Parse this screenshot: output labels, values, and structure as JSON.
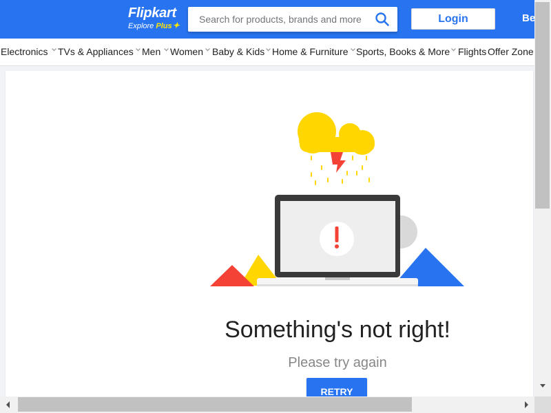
{
  "header": {
    "logo_main": "Flipkart",
    "logo_sub": "Explore",
    "logo_plus": "Plus",
    "search_placeholder": "Search for products, brands and more",
    "login_label": "Login",
    "cut_text": "Be"
  },
  "nav": {
    "items": [
      {
        "label": "Electronics",
        "has_chevron": true
      },
      {
        "label": "TVs & Appliances",
        "has_chevron": true
      },
      {
        "label": "Men",
        "has_chevron": true
      },
      {
        "label": "Women",
        "has_chevron": true
      },
      {
        "label": "Baby & Kids",
        "has_chevron": true
      },
      {
        "label": "Home & Furniture",
        "has_chevron": true
      },
      {
        "label": "Sports, Books & More",
        "has_chevron": true
      },
      {
        "label": "Flights",
        "has_chevron": false
      },
      {
        "label": "Offer Zone",
        "has_chevron": false
      }
    ]
  },
  "error": {
    "title": "Something's not right!",
    "subtitle": "Please try again",
    "retry_label": "RETRY"
  },
  "colors": {
    "brand_blue": "#2874f0",
    "brand_yellow": "#ffe500",
    "cloud_yellow": "#ffd600",
    "bolt_red": "#f44336",
    "alert_red": "#f44336"
  },
  "icons": {
    "search": "search-icon",
    "chevron": "chevron-down-icon",
    "illustration": "error-laptop-cloud-illustration"
  }
}
